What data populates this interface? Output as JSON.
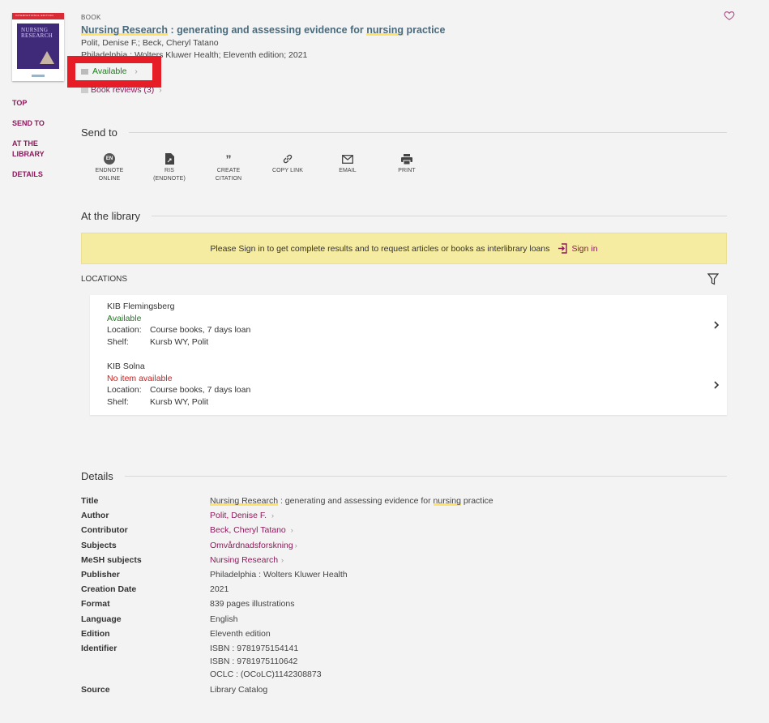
{
  "record": {
    "type_label": "BOOK",
    "title_part1": "Nursing Research",
    "title_part2": " : generating and assessing evidence for ",
    "title_part3": "nursing",
    "title_part4": " practice",
    "authors": "Polit, Denise F.; Beck, Cheryl Tatano",
    "publication": "Philadelphia : Wolters Kluwer Health; Eleventh edition; 2021",
    "availability": "Available",
    "reviews": "Book reviews (3)",
    "cover_band": "INTERNATIONAL EDITION",
    "cover_title_line1": "NURSING",
    "cover_title_line2": "RESEARCH"
  },
  "left_nav": [
    {
      "label": "TOP"
    },
    {
      "label": "SEND TO"
    },
    {
      "label": "AT THE LIBRARY"
    },
    {
      "label": "DETAILS"
    }
  ],
  "send_to": {
    "heading": "Send to",
    "items": [
      {
        "label_line1": "ENDNOTE",
        "label_line2": "ONLINE",
        "icon": "endnote-icon",
        "icon_text": "EN"
      },
      {
        "label_line1": "RIS",
        "label_line2": "(ENDNOTE)",
        "icon": "file-icon"
      },
      {
        "label_line1": "CREATE",
        "label_line2": "CITATION",
        "icon": "quote-icon"
      },
      {
        "label_line1": "COPY LINK",
        "label_line2": "",
        "icon": "link-icon"
      },
      {
        "label_line1": "EMAIL",
        "label_line2": "",
        "icon": "mail-icon"
      },
      {
        "label_line1": "PRINT",
        "label_line2": "",
        "icon": "print-icon"
      }
    ]
  },
  "library": {
    "heading": "At the library",
    "banner_text": "Please Sign in to get complete results and to request articles or books as interlibrary loans",
    "sign_in_label": "Sign in",
    "locations_label": "LOCATIONS",
    "locations": [
      {
        "name": "KIB Flemingsberg",
        "status": "Available",
        "status_type": "available",
        "location_label": "Location:",
        "location": "Course books, 7 days loan",
        "shelf_label": "Shelf:",
        "shelf": "Kursb WY, Polit"
      },
      {
        "name": "KIB Solna",
        "status": "No item available",
        "status_type": "unavailable",
        "location_label": "Location:",
        "location": "Course books, 7 days loan",
        "shelf_label": "Shelf:",
        "shelf": "Kursb WY, Polit"
      }
    ]
  },
  "details": {
    "heading": "Details",
    "rows": [
      {
        "label": "Title",
        "value_hl1": "Nursing Research",
        "value_mid": " : generating and assessing evidence for ",
        "value_hl2": "nursing",
        "value_end": " practice"
      },
      {
        "label": "Author",
        "value": "Polit, Denise F."
      },
      {
        "label": "Contributor",
        "value": "Beck, Cheryl Tatano"
      },
      {
        "label": "Subjects",
        "value": "Omvårdnadsforskning"
      },
      {
        "label": "MeSH subjects",
        "value": "Nursing Research"
      },
      {
        "label": "Publisher",
        "value": "Philadelphia : Wolters Kluwer Health"
      },
      {
        "label": "Creation Date",
        "value": "2021"
      },
      {
        "label": "Format",
        "value": "839 pages illustrations"
      },
      {
        "label": "Language",
        "value": "English"
      },
      {
        "label": "Edition",
        "value": "Eleventh edition"
      },
      {
        "label": "Identifier",
        "values": [
          "ISBN : 9781975154141",
          "ISBN : 9781975110642",
          "OCLC : (OCoLC)1142308873"
        ]
      },
      {
        "label": "Source",
        "value": "Library Catalog"
      }
    ]
  },
  "colors": {
    "accent": "#8e1a5b",
    "title": "#4a6b7c",
    "available": "#1f7a1f",
    "unavailable": "#d21f1f",
    "banner": "#f6eca1",
    "highlight_box": "#e61d27"
  }
}
